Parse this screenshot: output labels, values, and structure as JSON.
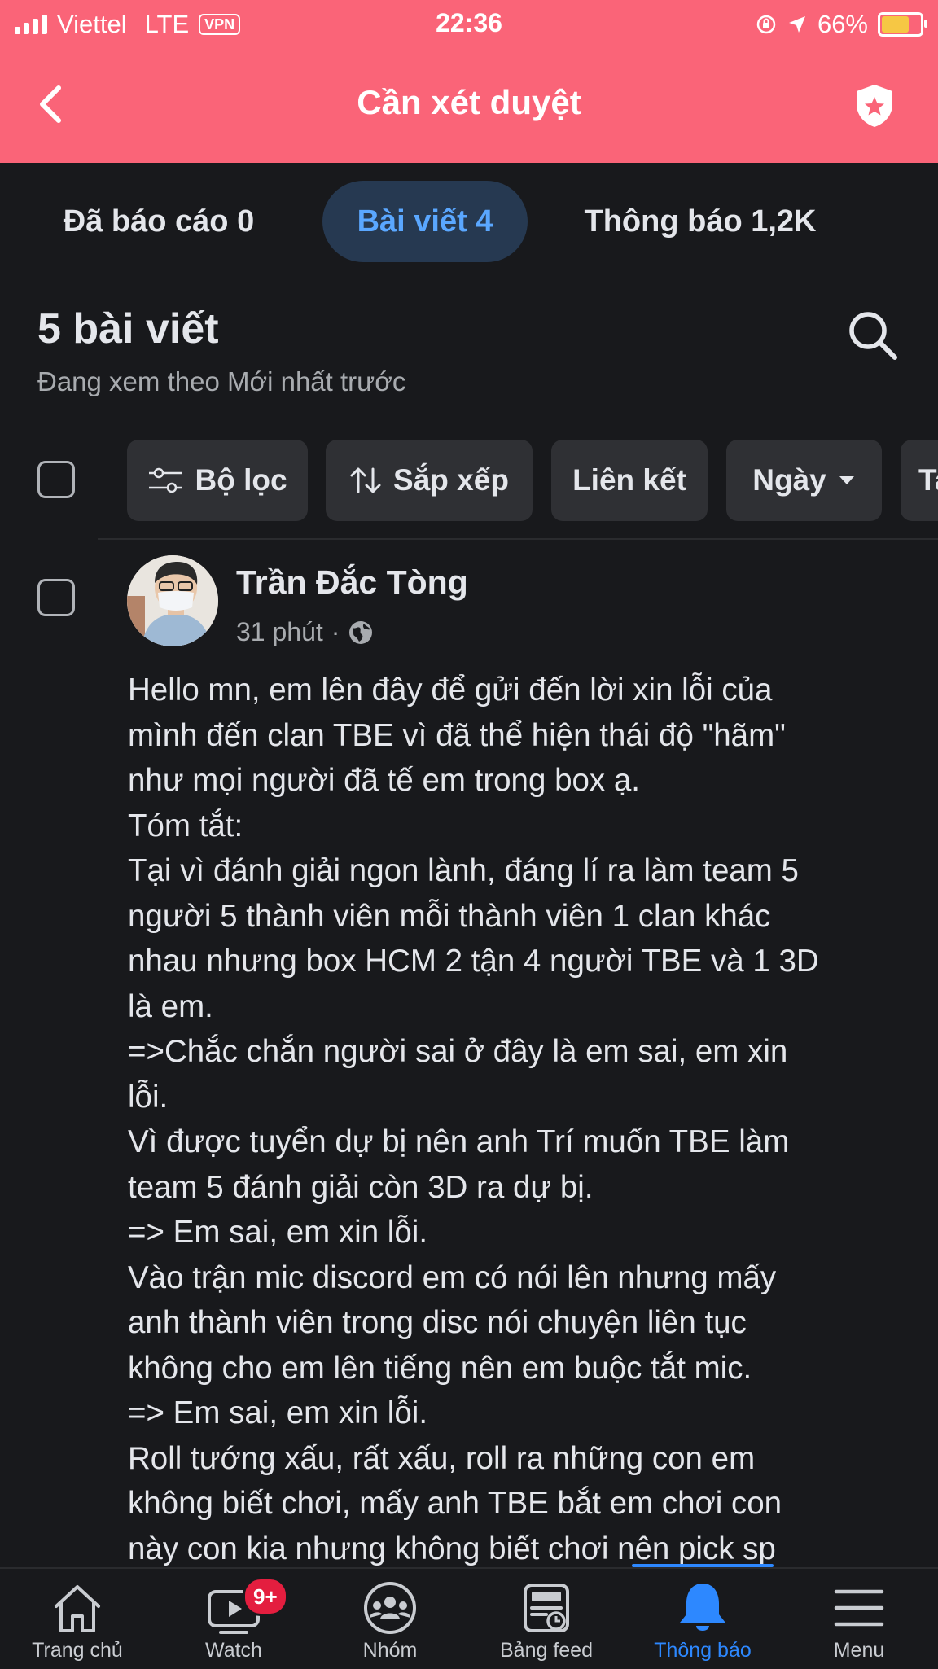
{
  "status_bar": {
    "carrier": "Viettel",
    "network": "LTE",
    "vpn": "VPN",
    "time": "22:36",
    "battery": "66%",
    "battery_level": 0.66
  },
  "header": {
    "title": "Cần xét duyệt"
  },
  "tabs": [
    {
      "label": "Đã báo cáo 0",
      "active": false
    },
    {
      "label": "Bài viết 4",
      "active": true
    },
    {
      "label": "Thông báo 1,2K",
      "active": false
    }
  ],
  "list": {
    "count_title": "5 bài viết",
    "sort_caption": "Đang xem theo Mới nhất trước"
  },
  "filters": [
    {
      "label": "Bộ lọc",
      "icon": "filter-sliders-icon"
    },
    {
      "label": "Sắp xếp",
      "icon": "sort-arrows-icon"
    },
    {
      "label": "Liên kết"
    },
    {
      "label": "Ngày",
      "icon": "caret-down-icon"
    },
    {
      "label": "Ta"
    }
  ],
  "post": {
    "author": "Trần Đắc Tòng",
    "time": "31 phút",
    "privacy_icon": "globe-icon",
    "body": "Hello mn, em lên đây để gửi đến lời xin lỗi của\nmình đến clan TBE vì đã thể hiện thái độ \"hãm\"\nnhư mọi người đã tế em trong box ạ.\nTóm tắt:\nTại vì đánh giải ngon lành, đáng lí ra làm team 5\nngười 5 thành viên mỗi thành viên 1 clan khác\nnhau nhưng box HCM 2 tận 4 người TBE và 1 3D\nlà em.\n=>Chắc chắn người sai ở đây là em sai, em xin\nlỗi.\nVì được tuyển dự bị nên anh Trí muốn TBE làm\nteam 5 đánh giải còn 3D ra dự bị.\n=> Em sai, em xin lỗi.\nVào trận mic discord em có nói lên nhưng mấy\nanh thành viên trong disc nói chuyện liên tục\nkhông cho em lên tiếng nên em buộc tắt mic.\n=> Em sai, em xin lỗi.\nRoll tướng xấu, rất xấu, roll ra những con em\nkhông biết chơi, mấy anh TBE bắt em chơi con\nnày con kia nhưng không biết chơi nên pick sp"
  },
  "bottom_nav": [
    {
      "label": "Trang chủ",
      "icon": "home-icon",
      "active": false
    },
    {
      "label": "Watch",
      "icon": "watch-video-icon",
      "badge": "9+",
      "active": false
    },
    {
      "label": "Nhóm",
      "icon": "groups-icon",
      "active": false
    },
    {
      "label": "Bảng feed",
      "icon": "feeds-icon",
      "active": false
    },
    {
      "label": "Thông báo",
      "icon": "bell-icon",
      "active": true
    },
    {
      "label": "Menu",
      "icon": "menu-icon",
      "active": false
    }
  ],
  "colors": {
    "header_bg": "#fa6478",
    "page_bg": "#18191c",
    "accent": "#2d88ff",
    "active_tab_bg": "#263951",
    "badge": "#e41e3f"
  }
}
